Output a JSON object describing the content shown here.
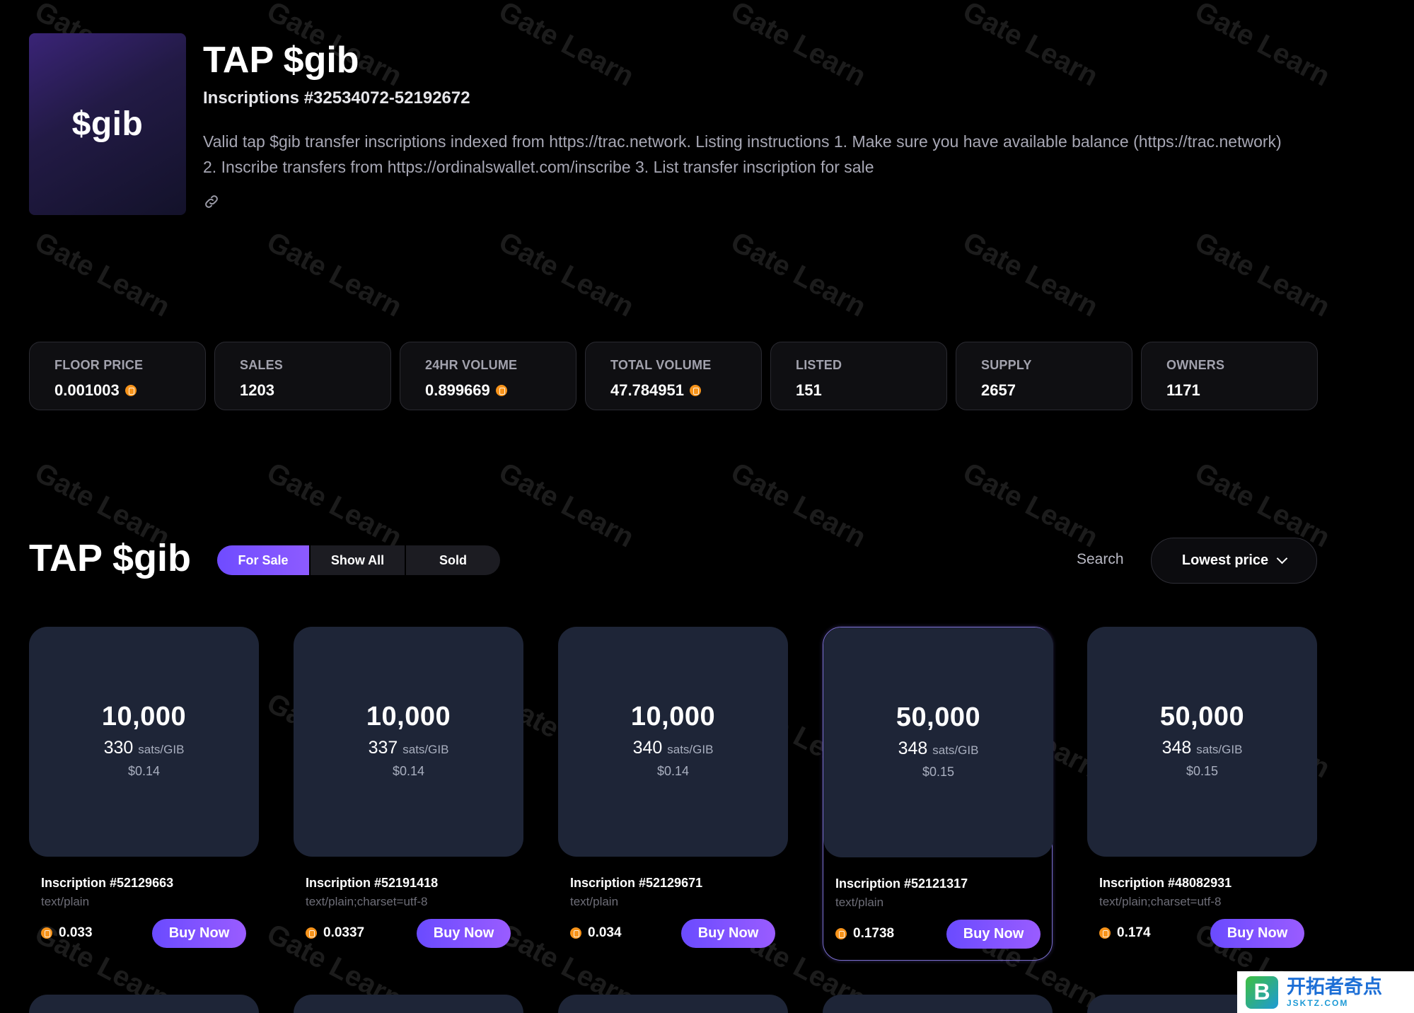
{
  "header": {
    "logo_text": "$gib",
    "title": "TAP $gib",
    "inscriptions": "Inscriptions #32534072-52192672",
    "description": "Valid tap $gib transfer inscriptions indexed from https://trac.network. Listing instructions 1. Make sure you have available balance (https://trac.network) 2. Inscribe transfers from https://ordinalswallet.com/inscribe 3. List transfer inscription for sale",
    "link_icon": "link-icon"
  },
  "stats": [
    {
      "label": "FLOOR PRICE",
      "value": "0.001003",
      "btc": true
    },
    {
      "label": "SALES",
      "value": "1203",
      "btc": false
    },
    {
      "label": "24HR VOLUME",
      "value": "0.899669",
      "btc": true
    },
    {
      "label": "TOTAL VOLUME",
      "value": "47.784951",
      "btc": true
    },
    {
      "label": "LISTED",
      "value": "151",
      "btc": false
    },
    {
      "label": "SUPPLY",
      "value": "2657",
      "btc": false
    },
    {
      "label": "OWNERS",
      "value": "1171",
      "btc": false
    }
  ],
  "collection": {
    "title": "TAP $gib",
    "filters": [
      "For Sale",
      "Show All",
      "Sold"
    ],
    "active_filter": "For Sale",
    "search_label": "Search",
    "sort_value": "Lowest price"
  },
  "cards": [
    {
      "amount": "10,000",
      "rate": "330",
      "rate_unit": "sats/GIB",
      "usd": "$0.14",
      "name": "Inscription #52129663",
      "type": "text/plain",
      "price": "0.033",
      "button": "Buy Now",
      "highlighted": false
    },
    {
      "amount": "10,000",
      "rate": "337",
      "rate_unit": "sats/GIB",
      "usd": "$0.14",
      "name": "Inscription #52191418",
      "type": "text/plain;charset=utf-8",
      "price": "0.0337",
      "button": "Buy Now",
      "highlighted": false
    },
    {
      "amount": "10,000",
      "rate": "340",
      "rate_unit": "sats/GIB",
      "usd": "$0.14",
      "name": "Inscription #52129671",
      "type": "text/plain",
      "price": "0.034",
      "button": "Buy Now",
      "highlighted": false
    },
    {
      "amount": "50,000",
      "rate": "348",
      "rate_unit": "sats/GIB",
      "usd": "$0.15",
      "name": "Inscription #52121317",
      "type": "text/plain",
      "price": "0.1738",
      "button": "Buy Now",
      "highlighted": true
    },
    {
      "amount": "50,000",
      "rate": "348",
      "rate_unit": "sats/GIB",
      "usd": "$0.15",
      "name": "Inscription #48082931",
      "type": "text/plain;charset=utf-8",
      "price": "0.174",
      "button": "Buy Now",
      "highlighted": false
    }
  ],
  "watermark": "Gate Learn",
  "badge": {
    "logo": "B",
    "main": "开拓者奇点",
    "sub": "JSKTZ.COM"
  },
  "colors": {
    "accent": "#7b55ff",
    "card_bg": "#1e2537",
    "btc": "#f7931a"
  }
}
